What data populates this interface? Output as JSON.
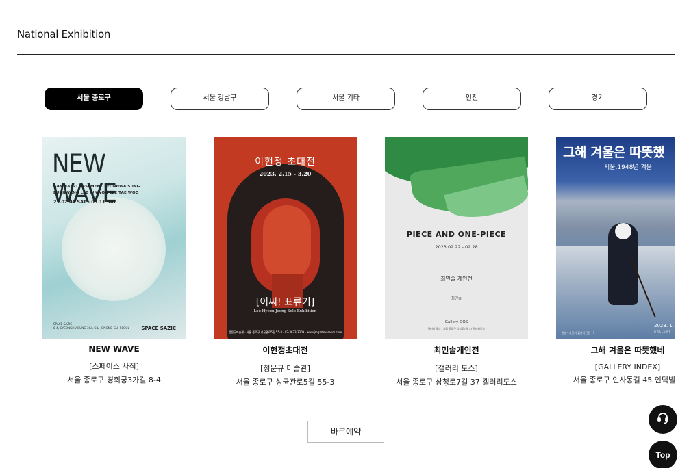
{
  "page": {
    "section_title": "National Exhibition"
  },
  "tabs": [
    {
      "label": "서울 종로구",
      "active": true
    },
    {
      "label": "서울 강남구",
      "active": false
    },
    {
      "label": "서울 기타",
      "active": false
    },
    {
      "label": "인천",
      "active": false
    },
    {
      "label": "경기",
      "active": false
    }
  ],
  "exhibitions": [
    {
      "title": "NEW WAVE",
      "venue": "[스페이스 사직]",
      "address": "서울 종로구 경희궁3가길 8-4",
      "poster": {
        "headline": "NEW WAVE",
        "line1": "GAMMANZI  BASEMENT  YEONHWA SUNG",
        "line2": "EUNHWANG LEE  JUNWON LEE  TAE WOO",
        "dates": "23.02.04 SAT - 03.11 SAT",
        "footer1": "SPACE SAZIC",
        "footer2": "8-4, GYEONGHUIGUNG 3GA-GIL, JONGNO-GU, SEOUL",
        "brand": "SPACE SAZIC"
      }
    },
    {
      "title": "이현정초대전",
      "venue": "[정문규 미술관]",
      "address": "서울 종로구 성균관로5길 55-3",
      "poster": {
        "headline": "이현정 초대전",
        "dates": "2023. 2.15 - 3.20",
        "subtitle": "[이씨! 표류기]",
        "english": "Lee Hyeon Jeong Solo Exhibition",
        "footer": "정문규미술관 · 서울 종로구 성균관로5길 55-3 · 02-3673-3309 · www.jmgartmuseum.com"
      }
    },
    {
      "title": "최민솔개인전",
      "venue": "[갤러리 도스]",
      "address": "서울 종로구 삼청로7길 37 갤러리도스",
      "poster": {
        "headline": "PIECE AND ONE-PIECE",
        "dates": "2023.02.22 - 02.28",
        "name": "최민솔 개인전",
        "signature": "최민솔",
        "brand": "Gallery DOS",
        "footer": "갤러리 도스 · 서울 종로구 삼청로7길 37 갤러리도스"
      }
    },
    {
      "title": "그해 겨울은 따뜻했네",
      "venue": "[GALLERY INDEX]",
      "address": "서울 종로구 인사동길 45 인덕빌딩",
      "poster": {
        "headline": "그해 겨울은 따뜻했",
        "subtitle": "서울,1948년 겨울",
        "dates": "2023. 1.",
        "brand": "GALLERY",
        "footer": "한영수사진가 출판사진전 - 1"
      }
    }
  ],
  "buttons": {
    "reserve": "바로예약",
    "top": "Top"
  },
  "icons": {
    "chat": "headset-chat-icon"
  },
  "colors": {
    "accent": "#000000",
    "fab": "#111111"
  }
}
